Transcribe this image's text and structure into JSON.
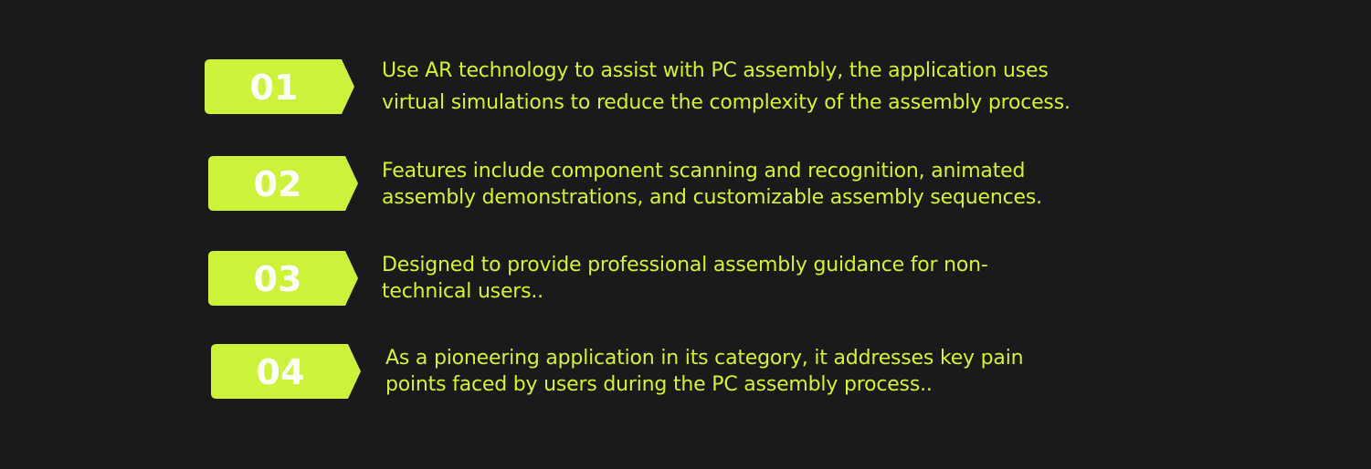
{
  "colors": {
    "background": "#1a1a1a",
    "accent": "#cdf23a",
    "badge_text": "#ffffff",
    "body_text": "#d4f52a"
  },
  "items": [
    {
      "number": "01",
      "lines": [
        "Use AR technology to assist with PC assembly, the application uses",
        "virtual simulations to reduce the complexity of the assembly process."
      ]
    },
    {
      "number": "02",
      "lines": [
        "Features include component scanning and recognition, animated",
        "assembly demonstrations, and customizable assembly sequences."
      ]
    },
    {
      "number": "03",
      "lines": [
        "Designed to provide professional assembly guidance for non-",
        "technical users.."
      ]
    },
    {
      "number": "04",
      "lines": [
        "As a pioneering application in its category, it addresses key pain",
        "points faced by users during the PC assembly process.."
      ]
    }
  ]
}
